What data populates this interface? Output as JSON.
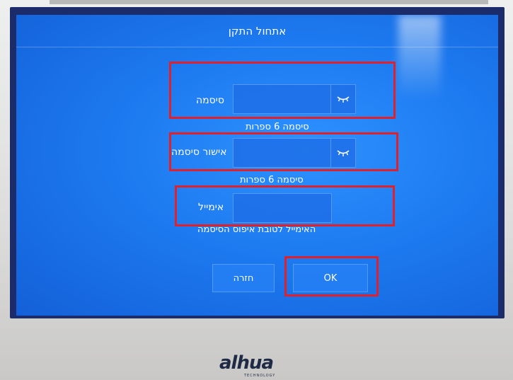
{
  "dialog": {
    "title": "אתחול התקן"
  },
  "form": {
    "password_label": "סיסמה",
    "password_hint": "סיסמה 6 ספרות",
    "confirm_label": "אישור סיסמה",
    "confirm_hint": "סיסמה 6 ספרות",
    "email_label": "אימייל",
    "email_hint": "האימייל לטובת איפוס הסיסמה"
  },
  "buttons": {
    "back_label": "חזרה",
    "ok_label": "OK"
  },
  "icons": {
    "password_toggle": "eye-closed-icon",
    "confirm_toggle": "eye-closed-icon"
  },
  "branding": {
    "logo": "alhua",
    "sub": "TECHNOLOGY"
  },
  "colors": {
    "screen": "#1d7af0",
    "highlight": "#e0202a",
    "text": "#ffffff"
  }
}
